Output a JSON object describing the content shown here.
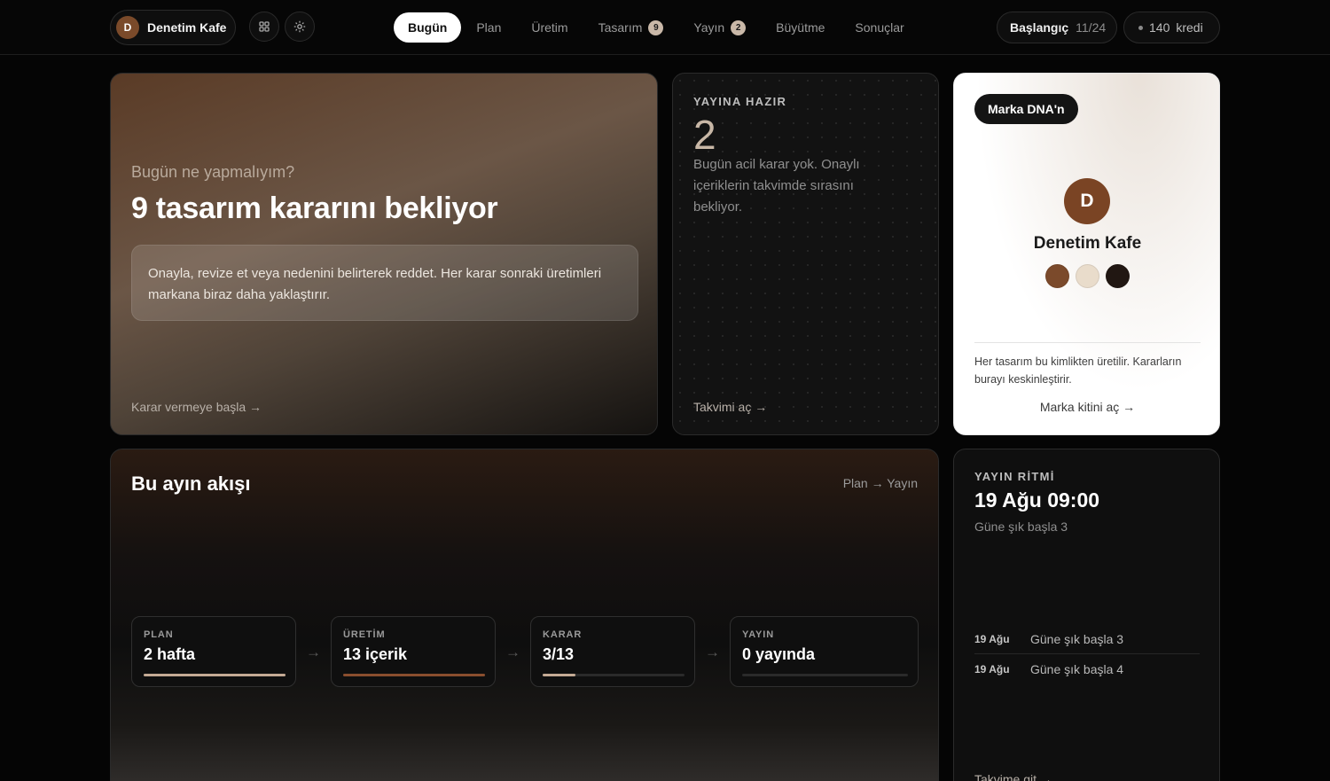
{
  "topbar": {
    "brand": {
      "initial": "D",
      "name": "Denetim Kafe"
    },
    "icons": {
      "grid": "grid-icon",
      "settings": "gear-icon"
    },
    "nav": [
      {
        "label": "Bugün",
        "active": true,
        "badge": null
      },
      {
        "label": "Plan",
        "active": false,
        "badge": null
      },
      {
        "label": "Üretim",
        "active": false,
        "badge": null
      },
      {
        "label": "Tasarım",
        "active": false,
        "badge": "9"
      },
      {
        "label": "Yayın",
        "active": false,
        "badge": "2"
      },
      {
        "label": "Büyütme",
        "active": false,
        "badge": null
      },
      {
        "label": "Sonuçlar",
        "active": false,
        "badge": null
      }
    ],
    "plan": {
      "label": "Başlangıç",
      "value": "11/24"
    },
    "credit": {
      "amount": "140",
      "label": "kredi"
    }
  },
  "hero": {
    "eyebrow": "Bugün ne yapmalıyım?",
    "title": "9 tasarım kararını bekliyor",
    "description": "Onayla, revize et veya nedenini belirterek reddet. Her karar sonraki üretimleri markana biraz daha yaklaştırır.",
    "link": "Karar vermeye başla →"
  },
  "ready": {
    "eyebrow": "YAYINA HAZIR",
    "count": "2",
    "text": "Bugün acil karar yok. Onaylı içeriklerin takvimde sırasını bekliyor.",
    "link": "Takvimi aç →"
  },
  "dna": {
    "chip": "Marka DNA'n",
    "initial": "D",
    "name": "Denetim Kafe",
    "colors": [
      "#7b4a2b",
      "#e9dccb",
      "#211712"
    ],
    "text": "Her tasarım bu kimlikten üretilir. Kararların burayı keskinleştirir.",
    "link": "Marka kitini aç →"
  },
  "flow": {
    "title": "Bu ayın akışı",
    "side": "Plan → Yayın",
    "arrow": "→",
    "steps": [
      {
        "label": "PLAN",
        "value": "2 hafta",
        "progress": 1.0,
        "color": "#c4aa94"
      },
      {
        "label": "ÜRETİM",
        "value": "13 içerik",
        "progress": 1.0,
        "color": "#8a4e2e"
      },
      {
        "label": "KARAR",
        "value": "3/13",
        "progress": 0.23,
        "color": "#c4aa94"
      },
      {
        "label": "YAYIN",
        "value": "0 yayında",
        "progress": 0,
        "color": "#c4aa94"
      }
    ]
  },
  "rhythm": {
    "eyebrow": "YAYIN RİTMİ",
    "title": "19 Ağu 09:00",
    "subtitle": "Güne şık başla 3",
    "rows": [
      {
        "date": "19 Ağu",
        "text": "Güne şık başla 3"
      },
      {
        "date": "19 Ağu",
        "text": "Güne şık başla 4"
      }
    ],
    "link": "Takvime git →"
  }
}
